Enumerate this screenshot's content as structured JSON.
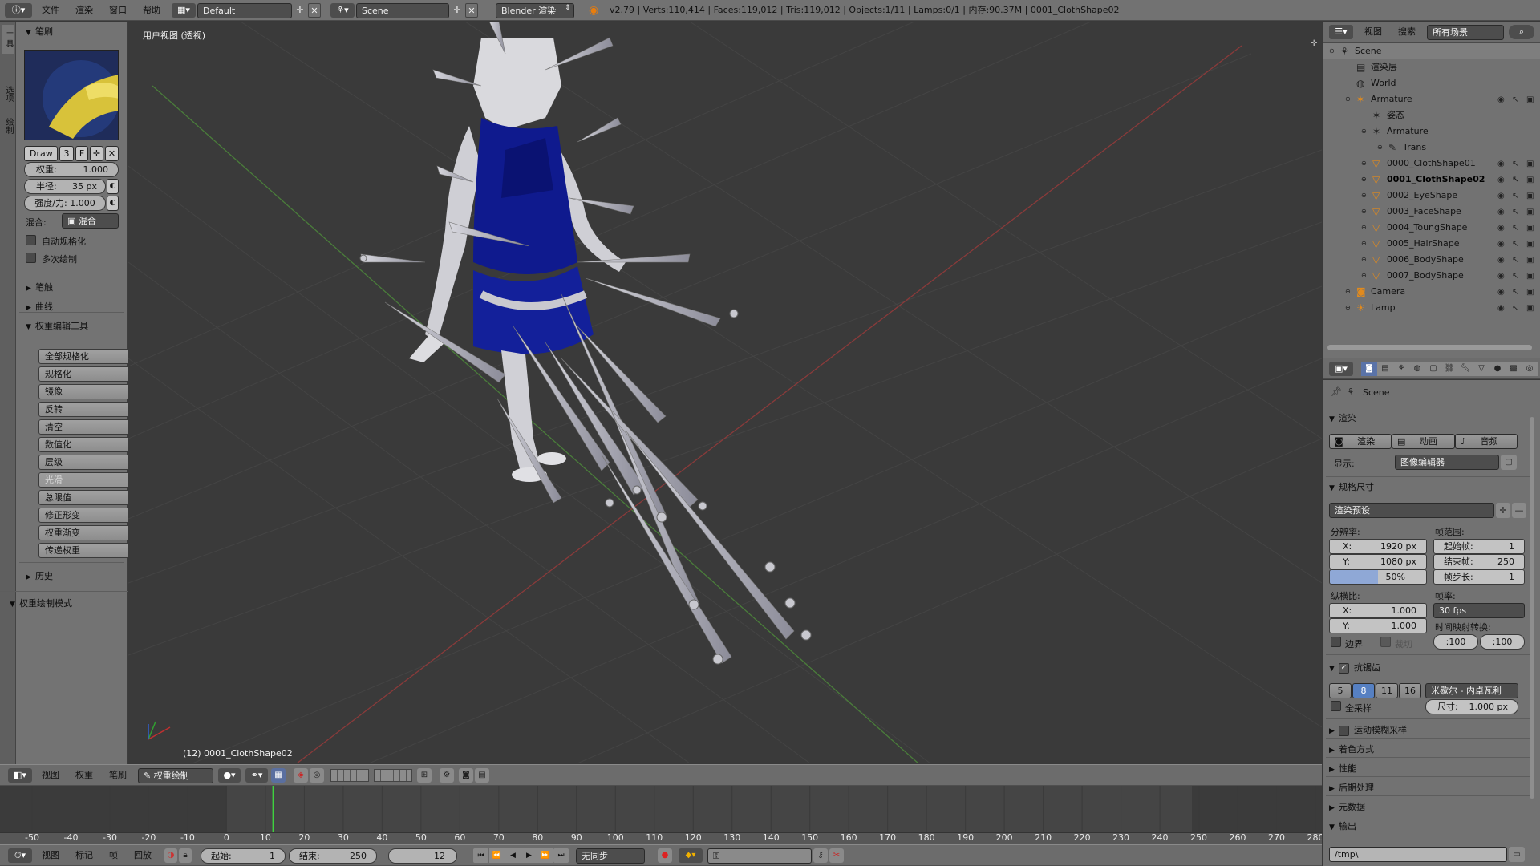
{
  "topbar": {
    "menus": [
      "文件",
      "渲染",
      "窗口",
      "帮助"
    ],
    "layout": "Default",
    "scene": "Scene",
    "engine": "Blender 渲染",
    "stats": "v2.79 | Verts:110,414 | Faces:119,012 | Tris:119,012 | Objects:1/11 | Lamps:0/1 | 内存:90.37M | 0001_ClothShape02"
  },
  "left_tabs": [
    "工具",
    "选项",
    "绘制"
  ],
  "tool": {
    "brush_header": "笔刷",
    "brush_name": "Draw",
    "brush_users": "3",
    "brush_fake": "F",
    "weight": "权重:",
    "weight_value": "1.000",
    "radius": "半径:",
    "radius_value": "35 px",
    "strength": "强度/力: 1.000",
    "blend": "混合:",
    "blend_value": "混合",
    "auto_normalize": "自动规格化",
    "multi_paint": "多次绘制",
    "stroke": "笔触",
    "curve": "曲线",
    "weight_tools": "权重编辑工具",
    "buttons": [
      "全部规格化",
      "规格化",
      "镜像",
      "反转",
      "清空",
      "数值化",
      "层级",
      "光滑",
      "总限值",
      "修正形变",
      "权重渐变",
      "传递权重"
    ],
    "history": "历史",
    "mode_panel": "权重绘制模式"
  },
  "viewport": {
    "view_label": "用户视图 (透视)",
    "object_label": "(12) 0001_ClothShape02"
  },
  "view_header": {
    "menus": [
      "视图",
      "权重",
      "笔刷"
    ],
    "mode": "权重绘制"
  },
  "timeline": {
    "ticks": [
      "-50",
      "-40",
      "-30",
      "-20",
      "-10",
      "0",
      "10",
      "20",
      "30",
      "40",
      "50",
      "60",
      "70",
      "80",
      "90",
      "100",
      "110",
      "120",
      "130",
      "140",
      "150",
      "160",
      "170",
      "180",
      "190",
      "200",
      "210",
      "220",
      "230",
      "240",
      "250",
      "260",
      "270",
      "280"
    ],
    "tick_values": [
      -50,
      -40,
      -30,
      -20,
      -10,
      0,
      10,
      20,
      30,
      40,
      50,
      60,
      70,
      80,
      90,
      100,
      110,
      120,
      130,
      140,
      150,
      160,
      170,
      180,
      190,
      200,
      210,
      220,
      230,
      240,
      250,
      260,
      270,
      280
    ],
    "current_frame": 12,
    "menus": [
      "视图",
      "标记",
      "帧",
      "回放"
    ],
    "start_label": "起始:",
    "start": "1",
    "end_label": "结束:",
    "end": "250",
    "frame": "12",
    "sync": "无同步"
  },
  "outliner": {
    "menus": [
      "视图",
      "搜索"
    ],
    "filter": "所有场景",
    "items": [
      {
        "label": "Scene",
        "icon": "scene-icon"
      },
      {
        "label": "渲染层",
        "icon": "render-layer-icon"
      },
      {
        "label": "World",
        "icon": "world-icon"
      },
      {
        "label": "Armature",
        "icon": "armature-icon"
      },
      {
        "label": "姿态",
        "icon": "pose-icon"
      },
      {
        "label": "Armature",
        "icon": "armature-data-icon"
      },
      {
        "label": "Trans",
        "icon": "bone-icon"
      },
      {
        "label": "0000_ClothShape01",
        "icon": "mesh-icon"
      },
      {
        "label": "0001_ClothShape02",
        "icon": "mesh-icon"
      },
      {
        "label": "0002_EyeShape",
        "icon": "mesh-icon"
      },
      {
        "label": "0003_FaceShape",
        "icon": "mesh-icon"
      },
      {
        "label": "0004_ToungShape",
        "icon": "mesh-icon"
      },
      {
        "label": "0005_HairShape",
        "icon": "mesh-icon"
      },
      {
        "label": "0006_BodyShape",
        "icon": "mesh-icon"
      },
      {
        "label": "0007_BodyShape",
        "icon": "mesh-icon"
      },
      {
        "label": "Camera",
        "icon": "camera-icon"
      },
      {
        "label": "Lamp",
        "icon": "lamp-icon"
      }
    ]
  },
  "props": {
    "scene": "Scene",
    "render_section": "渲染",
    "render_btn": "渲染",
    "anim_btn": "动画",
    "audio_btn": "音频",
    "display_label": "显示:",
    "display_value": "图像编辑器",
    "dimensions": "规格尺寸",
    "preset": "渲染预设",
    "resolution": "分辨率:",
    "res_x": "1920 px",
    "res_y": "1080 px",
    "res_pct": "50%",
    "frame_range": "帧范围:",
    "start_frame": "起始帧:",
    "start_frame_val": "1",
    "end_frame": "结束帧:",
    "end_frame_val": "250",
    "frame_step": "帧步长:",
    "frame_step_val": "1",
    "aspect": "纵横比:",
    "aspect_x": "1.000",
    "aspect_y": "1.000",
    "framerate": "帧率:",
    "fps": "30 fps",
    "time_remap": "时间映射转换:",
    "remap_old": ":100",
    "remap_new": ":100",
    "border": "边界",
    "crop": "裁切",
    "aa": "抗锯齿",
    "aa_samples": [
      "5",
      "8",
      "11",
      "16"
    ],
    "aa_filter": "米歇尔 - 内卓瓦利",
    "full_sample": "全采样",
    "size": "尺寸:",
    "size_val": "1.000 px",
    "motion_blur": "运动模糊采样",
    "shading": "着色方式",
    "performance": "性能",
    "postprocess": "后期处理",
    "metadata": "元数据",
    "output": "输出",
    "output_path": "/tmp\\",
    "x": "X:",
    "y": "Y:"
  },
  "colors": {
    "accent": "#5680c2",
    "mesh_blue": "#0b168a",
    "timeline_cursor": "#3fd13f"
  }
}
